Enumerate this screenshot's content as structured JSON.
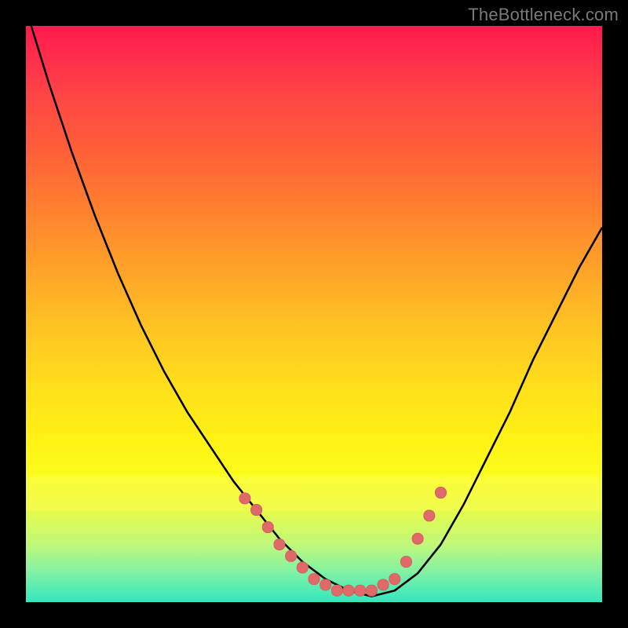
{
  "watermark": "TheBottleneck.com",
  "colors": {
    "curve": "#000000",
    "marker": "#e06a6a",
    "marker_stroke": "#d85f5f"
  },
  "chart_data": {
    "type": "line",
    "title": "",
    "xlabel": "",
    "ylabel": "",
    "xlim": [
      0,
      100
    ],
    "ylim": [
      0,
      100
    ],
    "grid": false,
    "legend": false,
    "series": [
      {
        "name": "bottleneck-curve",
        "x": [
          0,
          4,
          8,
          12,
          16,
          20,
          24,
          28,
          32,
          36,
          40,
          44,
          48,
          52,
          56,
          60,
          64,
          68,
          72,
          76,
          80,
          84,
          88,
          92,
          96,
          100
        ],
        "y": [
          103,
          90,
          78,
          67,
          57,
          48,
          40,
          33,
          27,
          21,
          16,
          11,
          7,
          4,
          2,
          1,
          2,
          5,
          10,
          17,
          25,
          33,
          42,
          50,
          58,
          65
        ]
      }
    ],
    "markers": {
      "name": "highlight-dots",
      "points": [
        {
          "x": 38,
          "y": 18
        },
        {
          "x": 40,
          "y": 16
        },
        {
          "x": 42,
          "y": 13
        },
        {
          "x": 44,
          "y": 10
        },
        {
          "x": 46,
          "y": 8
        },
        {
          "x": 48,
          "y": 6
        },
        {
          "x": 50,
          "y": 4
        },
        {
          "x": 52,
          "y": 3
        },
        {
          "x": 54,
          "y": 2
        },
        {
          "x": 56,
          "y": 2
        },
        {
          "x": 58,
          "y": 2
        },
        {
          "x": 60,
          "y": 2
        },
        {
          "x": 62,
          "y": 3
        },
        {
          "x": 64,
          "y": 4
        },
        {
          "x": 66,
          "y": 7
        },
        {
          "x": 68,
          "y": 11
        },
        {
          "x": 70,
          "y": 15
        },
        {
          "x": 72,
          "y": 19
        }
      ]
    }
  }
}
